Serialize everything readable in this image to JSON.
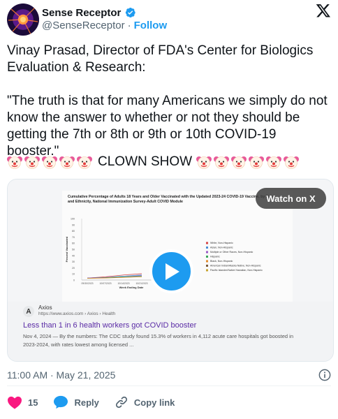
{
  "author": {
    "name": "Sense Receptor",
    "handle": "@SenseReceptor",
    "separator": "·",
    "follow_label": "Follow"
  },
  "tweet": {
    "text": "Vinay Prasad, Director of FDA's Center for Biologics Evaluation & Research:\n\n\"The truth is that for many Americans we simply do not know the answer to whether or not they should be getting the 7th or 8th or 9th or 10th COVID-19 booster.\"",
    "clown_label": "CLOWN SHOW"
  },
  "media": {
    "watch_label": "Watch on X",
    "chart_title": "Cumulative Percentage of Adults 18 Years and Older Vaccinated with the Updated 2023-24 COVID-19 Vaccine, by Race and Ethnicity, National Immunization Survey-Adult COVID Module",
    "chart_xlabel": "Week Ending Date",
    "chart_ylabel": "Percent Vaccinated",
    "yticks": [
      "100",
      "90",
      "80",
      "70",
      "60",
      "50",
      "40",
      "30",
      "20",
      "10",
      "0"
    ],
    "xticks": [
      "09/30/2023",
      "10/07/2023",
      "10/14/2023",
      "10/21/2023",
      "10/28/2023",
      "11/04/2023"
    ],
    "legend": [
      {
        "label": "White, Non-Hispanic",
        "color": "#d64545"
      },
      {
        "label": "Asian, Non-Hispanic",
        "color": "#4a8ed6"
      },
      {
        "label": "Multiple or Other Races, Non-Hispanic",
        "color": "#9a59c6"
      },
      {
        "label": "Hispanic",
        "color": "#3aa65a"
      },
      {
        "label": "Black, Non-Hispanic",
        "color": "#e08a2c"
      },
      {
        "label": "American Indian/Alaska Native, Non-Hispanic",
        "color": "#7a5a3a"
      },
      {
        "label": "Pacific Islander/Native Hawaiian, Non-Hispanic",
        "color": "#c7a530"
      }
    ]
  },
  "link_card": {
    "site_icon": "A",
    "site_name": "Axios",
    "site_url": "https://www.axios.com › Axios › Health",
    "title": "Less than 1 in 6 health workers got COVID booster",
    "desc": "Nov 4, 2024 — By the numbers: The CDC study found 15.3% of workers in 4,112 acute care hospitals got boosted in 2023-2024, with rates lowest among licensed ..."
  },
  "meta": {
    "timestamp": "11:00 AM · May 21, 2025"
  },
  "actions": {
    "like_count": "15",
    "reply_label": "Reply",
    "copy_label": "Copy link"
  },
  "colors": {
    "accent": "#1d9bf0",
    "like": "#f91880",
    "link_title": "#5a2ba5"
  },
  "icons": [
    "avatar-image",
    "verified-badge-icon",
    "x-logo-icon",
    "clown-face-icon",
    "play-icon",
    "info-icon",
    "heart-icon",
    "reply-icon",
    "link-icon"
  ]
}
